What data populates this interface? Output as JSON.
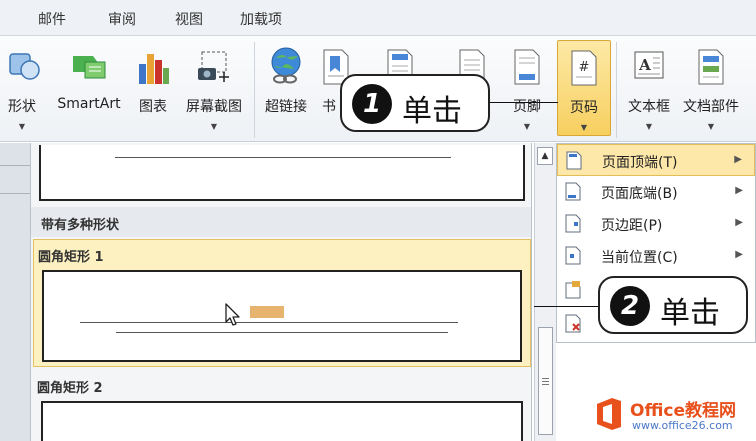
{
  "menubar": {
    "tabs": [
      "邮件",
      "审阅",
      "视图",
      "加载项"
    ]
  },
  "ribbon": {
    "buttons": [
      {
        "label": "形状",
        "icon": "shapes-icon"
      },
      {
        "label": "SmartArt",
        "icon": "smartart-icon"
      },
      {
        "label": "图表",
        "icon": "chart-icon"
      },
      {
        "label": "屏幕截图",
        "icon": "screenshot-icon"
      },
      {
        "label": "超链接",
        "icon": "hyperlink-icon"
      },
      {
        "label": "书",
        "icon": "bookmark-icon"
      },
      {
        "label": "页脚",
        "icon": "footer-icon"
      },
      {
        "label": "页码",
        "icon": "page-number-icon"
      },
      {
        "label": "文本框",
        "icon": "textbox-icon"
      },
      {
        "label": "文档部件",
        "icon": "quick-parts-icon"
      }
    ],
    "page_number_glyph": "#",
    "textbox_glyph": "A"
  },
  "gallery": {
    "section_title": "带有多种形状",
    "items": [
      {
        "name": "圆角矩形 1",
        "selected": true
      },
      {
        "name": "圆角矩形 2",
        "selected": false
      }
    ]
  },
  "submenu": {
    "items": [
      {
        "label": "页面顶端(T)",
        "has_submenu": true,
        "highlighted": true
      },
      {
        "label": "页面底端(B)",
        "has_submenu": true,
        "highlighted": false
      },
      {
        "label": "页边距(P)",
        "has_submenu": true,
        "highlighted": false
      },
      {
        "label": "当前位置(C)",
        "has_submenu": true,
        "highlighted": false
      }
    ]
  },
  "callouts": [
    {
      "number": "1",
      "text": "单击"
    },
    {
      "number": "2",
      "text": "单击"
    }
  ],
  "watermark": {
    "title": "Office教程网",
    "url": "www.office26.com"
  },
  "colors": {
    "highlight": "#f7cf5f",
    "selection": "#fdf1c2",
    "watermark_orange": "#e8501c",
    "watermark_blue": "#4c78c8"
  }
}
